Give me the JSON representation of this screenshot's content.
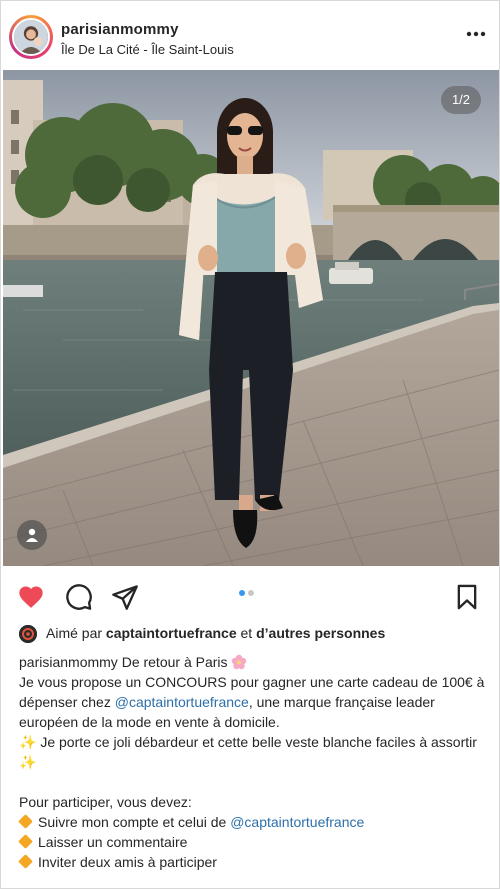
{
  "post": {
    "username": "parisianmommy",
    "location": "Île De La Cité - Île Saint-Louis",
    "image_counter": "1/2",
    "liked": true,
    "carousel": {
      "current": 1,
      "total": 2
    }
  },
  "likes": {
    "prefix": "Aimé par ",
    "liker": "captaintortuefrance",
    "suffix": " et ",
    "others": "d’autres personnes"
  },
  "caption": {
    "author": "parisianmommy",
    "line1_text": " De retour à Paris ",
    "para1_a": "Je vous propose un CONCOURS pour gagner une carte cadeau de 100€ à dépenser chez ",
    "para1_mention": "@captaintortuefrance",
    "para1_b": ", une marque française leader européen de la mode en vente à domicile.",
    "para2_text": " Je porte ce joli débardeur et cette belle veste blanche faciles à assortir",
    "para3": "Pour participer, vous devez:",
    "step1_text": "Suivre mon compte et celui de ",
    "step1_mention": "@captaintortuefrance",
    "step2": "Laisser un commentaire",
    "step3": "Inviter deux amis à participer"
  },
  "icons": {
    "more": "more-icon",
    "heart": "heart-icon",
    "comment": "comment-icon",
    "share": "share-icon",
    "save": "bookmark-icon",
    "tag": "user-tag-icon"
  },
  "colors": {
    "like": "#ed4956",
    "mention": "#2d6fa8",
    "dot_active": "#3897f0",
    "dot_inactive": "#c7c7c7"
  }
}
